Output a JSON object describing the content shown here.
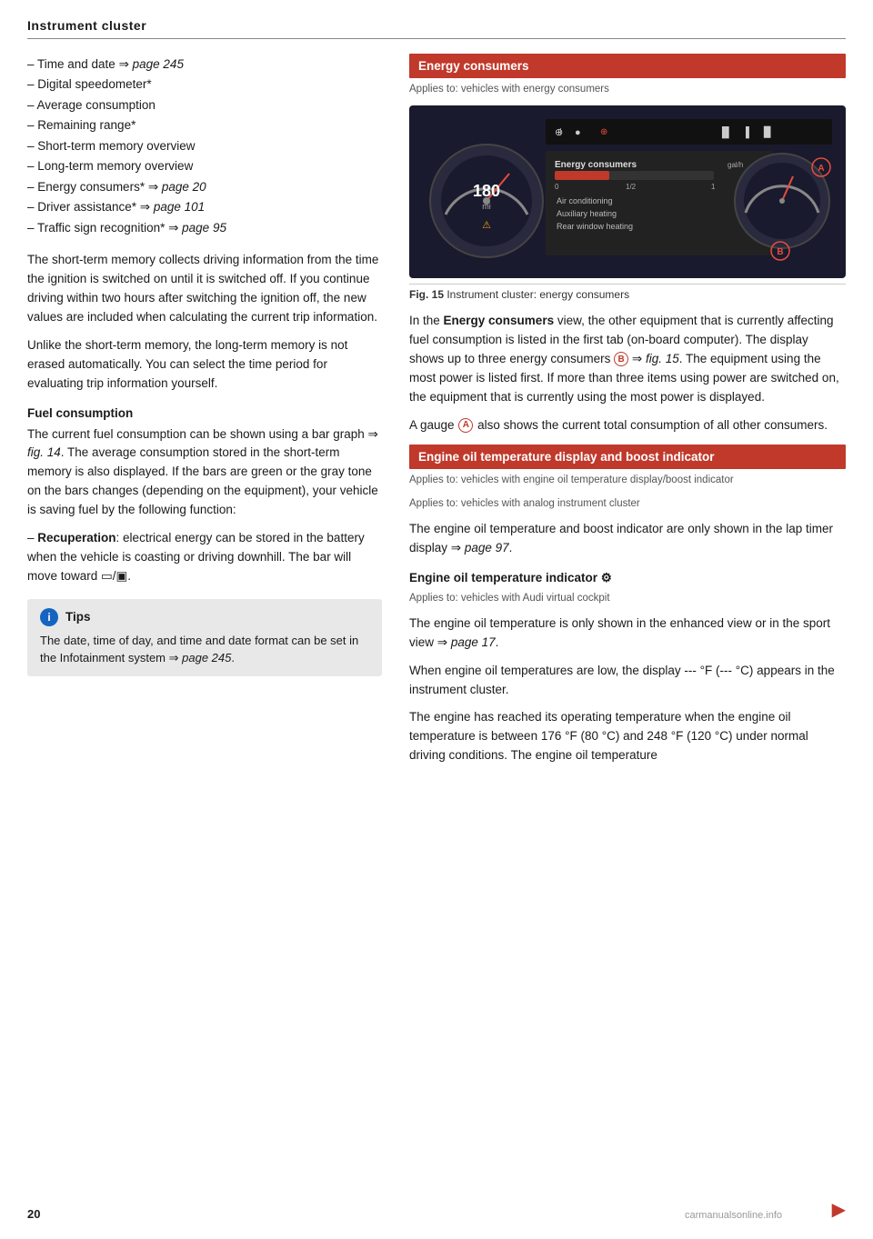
{
  "header": {
    "title": "Instrument cluster"
  },
  "page_number": "20",
  "left_col": {
    "bullets": [
      {
        "text": "Time and date ",
        "link": "page 245",
        "italic": true
      },
      {
        "text": "Digital speedometer*"
      },
      {
        "text": "Average consumption"
      },
      {
        "text": "Remaining range*"
      },
      {
        "text": "Short-term memory overview"
      },
      {
        "text": "Long-term memory overview"
      },
      {
        "text": "Energy consumers* ",
        "link": "page 20",
        "italic": true
      },
      {
        "text": "Driver assistance* ",
        "link": "page 101",
        "italic": true
      },
      {
        "text": "Traffic sign recognition* ",
        "link": "page 95",
        "italic": true
      }
    ],
    "short_term_memory_paragraph": "The short-term memory collects driving information from the time the ignition is switched on until it is switched off. If you continue driving within two hours after switching the ignition off, the new values are included when calculating the current trip information.",
    "long_term_memory_paragraph": "Unlike the short-term memory, the long-term memory is not erased automatically. You can select the time period for evaluating trip information yourself.",
    "fuel_section": {
      "heading": "Fuel consumption",
      "paragraph": "The current fuel consumption can be shown using a bar graph ⇒ fig. 14. The average consumption stored in the short-term memory is also displayed. If the bars are green or the gray tone on the bars changes (depending on the equipment), your vehicle is saving fuel by the following function:"
    },
    "recuperation": {
      "prefix": "Recuperation",
      "text": ": electrical energy can be stored in the battery when the vehicle is coasting or driving downhill. The bar will move toward □/■."
    },
    "tips_box": {
      "icon": "i",
      "label": "Tips",
      "body": "The date, time of day, and time and date format can be set in the Infotainment system ⇒ page 245."
    }
  },
  "right_col": {
    "section1": {
      "header": "Energy consumers",
      "applies_to": "Applies to: vehicles with energy consumers",
      "figure": {
        "speedometer_value": "180 mi",
        "inner_label": "Energy consumers",
        "gauge_label": "gal/h",
        "scale_start": "0",
        "scale_mid": "1/2",
        "scale_end": "1",
        "items": [
          "Air conditioning",
          "Auxiliary heating",
          "Rear window heating"
        ],
        "badge_a": "A",
        "badge_b": "B",
        "image_code": "BAU18347"
      },
      "fig_caption": "Fig. 15",
      "fig_caption_text": "Instrument cluster: energy consumers",
      "paragraph1": "In the Energy consumers view, the other equipment that is currently affecting fuel consumption is listed in the first tab (on-board computer). The display shows up to three energy consumers",
      "badge_b_inline": "B",
      "paragraph1b": "⇒ fig. 15. The equipment using the most power is listed first. If more than three items using power are switched on, the equipment that is currently using the most power is displayed.",
      "paragraph2_prefix": "A gauge",
      "badge_a_inline": "A",
      "paragraph2b": "also shows the current total consumption of all other consumers."
    },
    "section2": {
      "header": "Engine oil temperature display and boost indicator",
      "applies_to_1": "Applies to: vehicles with engine oil temperature display/boost indicator",
      "applies_to_2": "Applies to: vehicles with analog instrument cluster",
      "paragraph_analog": "The engine oil temperature and boost indicator are only shown in the lap timer display ⇒ page 97.",
      "sub_heading": "Engine oil temperature indicator",
      "sub_heading_icon": "⚘",
      "applies_to_3": "Applies to: vehicles with Audi virtual cockpit",
      "paragraph_virtual": "The engine oil temperature is only shown in the enhanced view or in the sport view ⇒ page 17.",
      "paragraph_low_temp": "When engine oil temperatures are low, the display --- °F (--- °C) appears in the instrument cluster.",
      "paragraph_operating": "The engine has reached its operating temperature when the engine oil temperature is between 176 °F (80 °C) and 248 °F (120 °C) under normal driving conditions. The engine oil temperature"
    }
  },
  "footer": {
    "watermark": "carmanualsonline.info"
  }
}
